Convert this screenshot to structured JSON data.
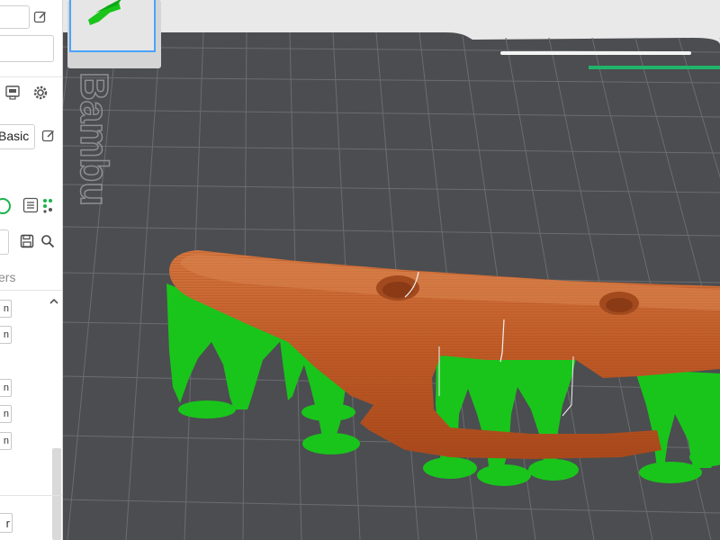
{
  "sidebar": {
    "preset_label": "Basic",
    "tab_label": "ers",
    "unit_suffix": "n",
    "bottom_button_label": "r"
  },
  "viewport": {
    "bed_brand": "Bambu",
    "colors": {
      "model": "#c8632c",
      "support": "#19c51b",
      "plate": "#4b4d50",
      "grid": "#6a6d70",
      "background": "#e9e9e9"
    }
  },
  "icons": {
    "edit": "edit-icon",
    "printer": "printer-icon",
    "settings": "gear-icon",
    "toggle": "toggle-circle-icon",
    "list": "list-icon",
    "compare": "compare-icon",
    "save": "save-icon",
    "search": "search-icon",
    "collapse": "chevron-up-icon"
  }
}
